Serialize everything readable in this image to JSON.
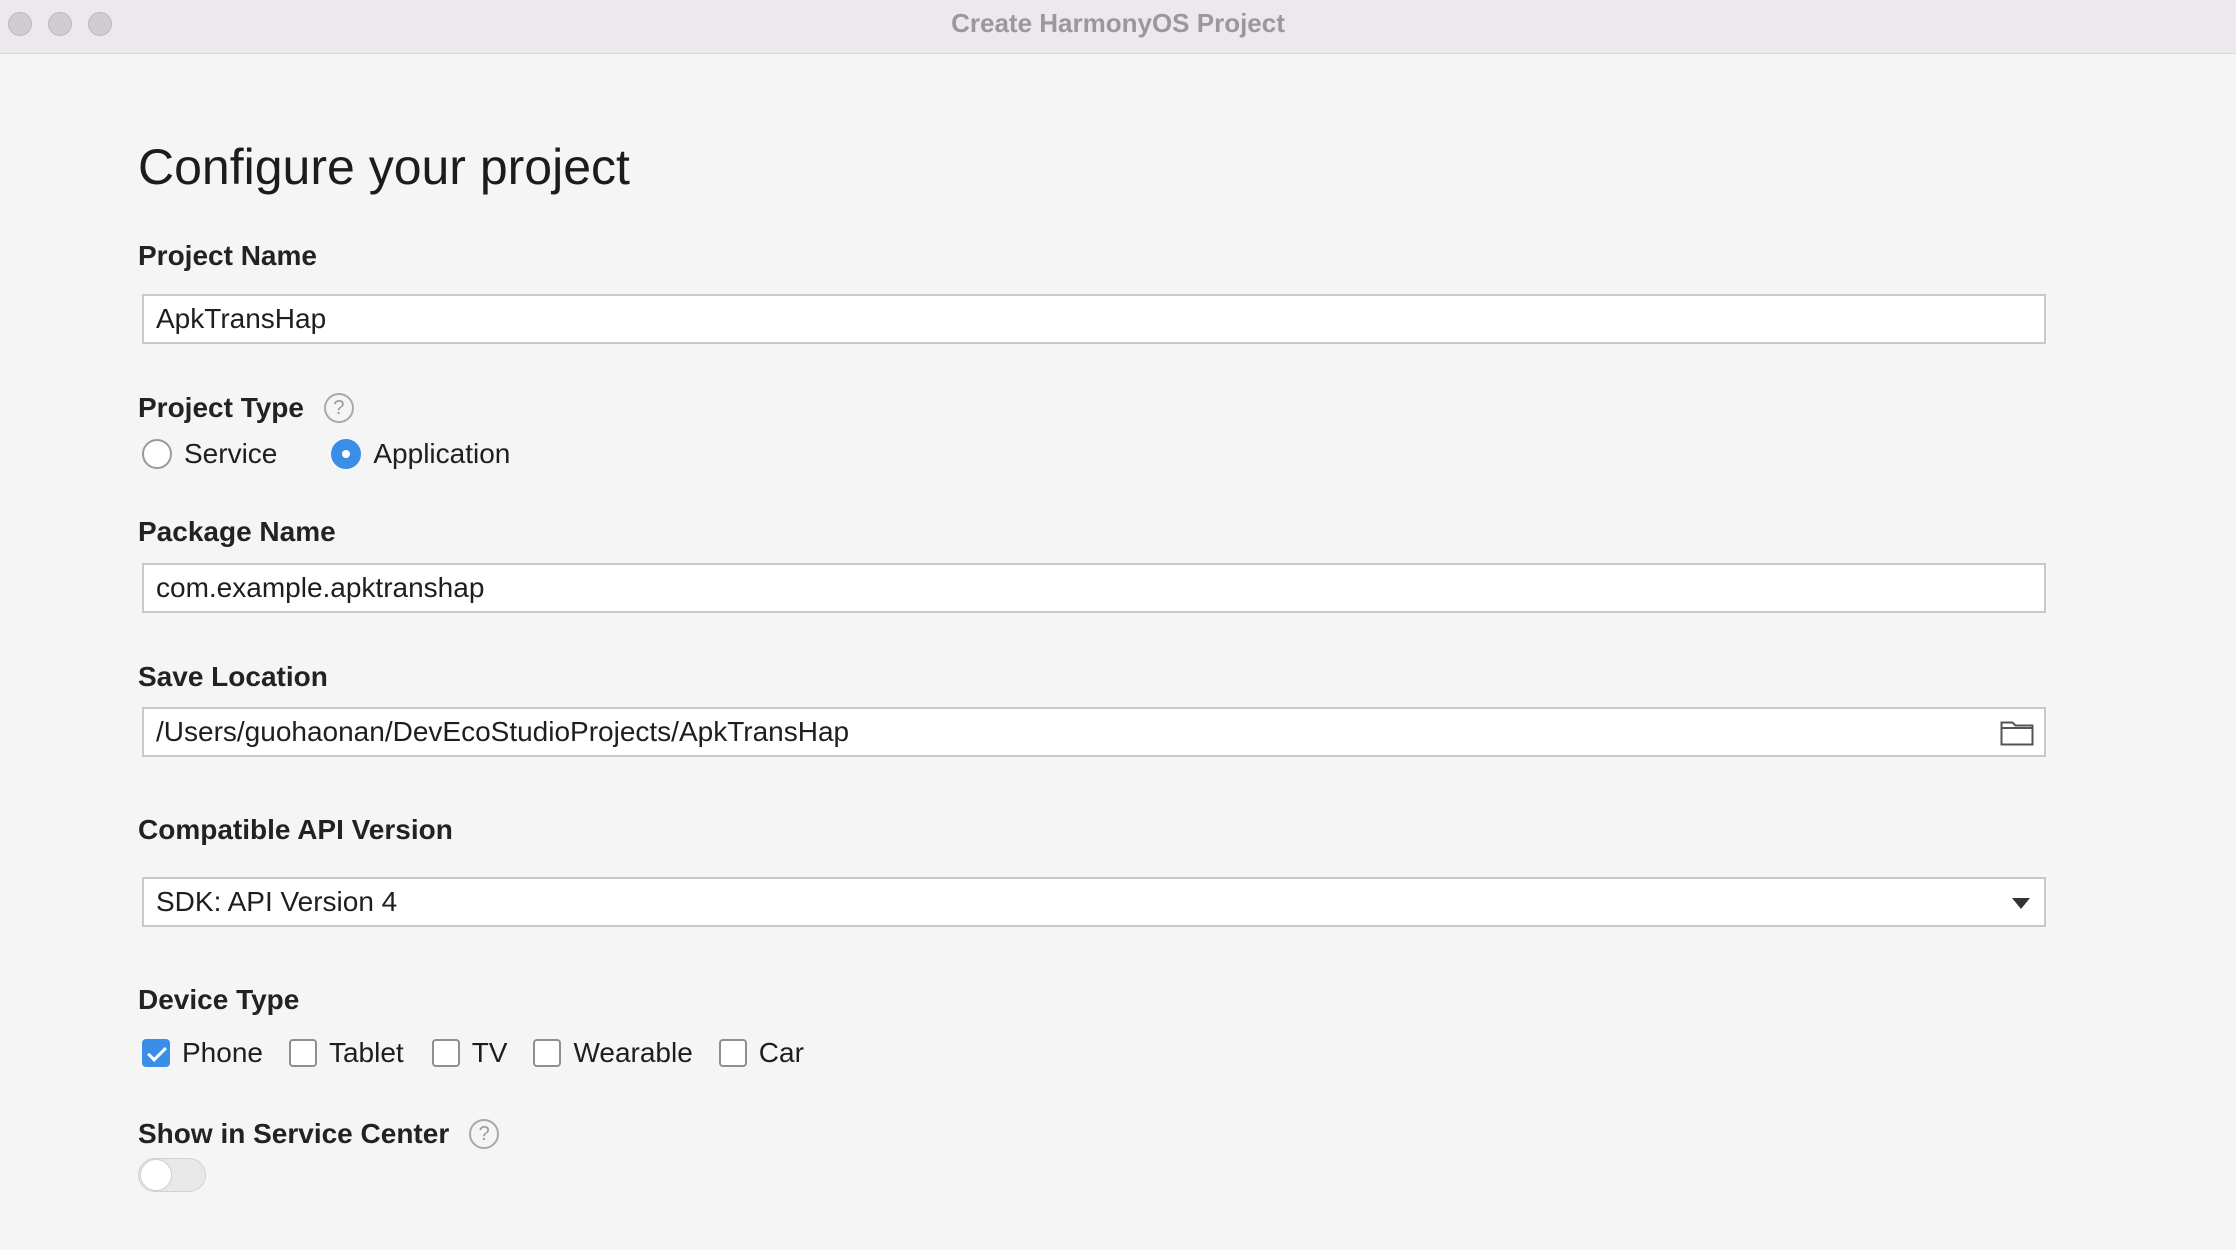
{
  "window": {
    "title": "Create HarmonyOS Project"
  },
  "page": {
    "title": "Configure your project"
  },
  "project_name": {
    "label": "Project Name",
    "value": "ApkTransHap"
  },
  "project_type": {
    "label": "Project Type",
    "help_icon": "help-circle-icon",
    "options": [
      "Service",
      "Application"
    ],
    "selected": "Application"
  },
  "package_name": {
    "label": "Package Name",
    "value": "com.example.apktranshap"
  },
  "save_location": {
    "label": "Save Location",
    "value": "/Users/guohaonan/DevEcoStudioProjects/ApkTransHap",
    "browse_icon": "folder-icon"
  },
  "api_version": {
    "label": "Compatible API Version",
    "selected": "SDK: API Version 4"
  },
  "device_type": {
    "label": "Device Type",
    "options": [
      {
        "label": "Phone",
        "checked": true
      },
      {
        "label": "Tablet",
        "checked": false
      },
      {
        "label": "TV",
        "checked": false
      },
      {
        "label": "Wearable",
        "checked": false
      },
      {
        "label": "Car",
        "checked": false
      }
    ]
  },
  "service_center": {
    "label": "Show in Service Center",
    "help_icon": "help-circle-icon",
    "enabled": false
  },
  "colors": {
    "accent": "#3b8ee8",
    "titlebar": "#ece8ee",
    "background": "#f5f5f5"
  }
}
